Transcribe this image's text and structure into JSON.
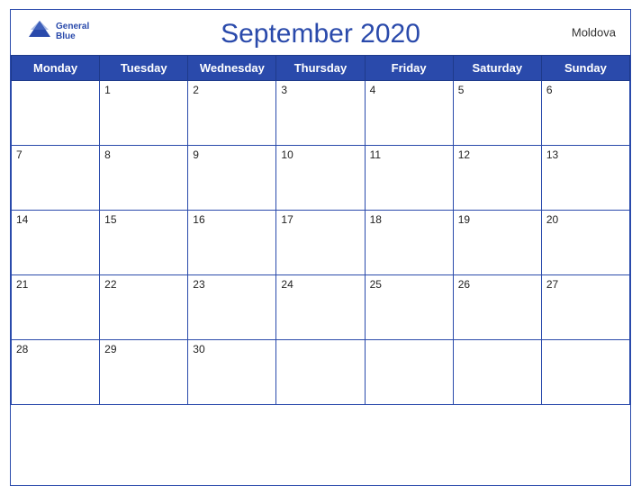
{
  "header": {
    "title": "September 2020",
    "country": "Moldova"
  },
  "logo": {
    "general": "General",
    "blue": "Blue"
  },
  "days": [
    "Monday",
    "Tuesday",
    "Wednesday",
    "Thursday",
    "Friday",
    "Saturday",
    "Sunday"
  ],
  "weeks": [
    [
      null,
      1,
      2,
      3,
      4,
      5,
      6
    ],
    [
      7,
      8,
      9,
      10,
      11,
      12,
      13
    ],
    [
      14,
      15,
      16,
      17,
      18,
      19,
      20
    ],
    [
      21,
      22,
      23,
      24,
      25,
      26,
      27
    ],
    [
      28,
      29,
      30,
      null,
      null,
      null,
      null
    ]
  ]
}
